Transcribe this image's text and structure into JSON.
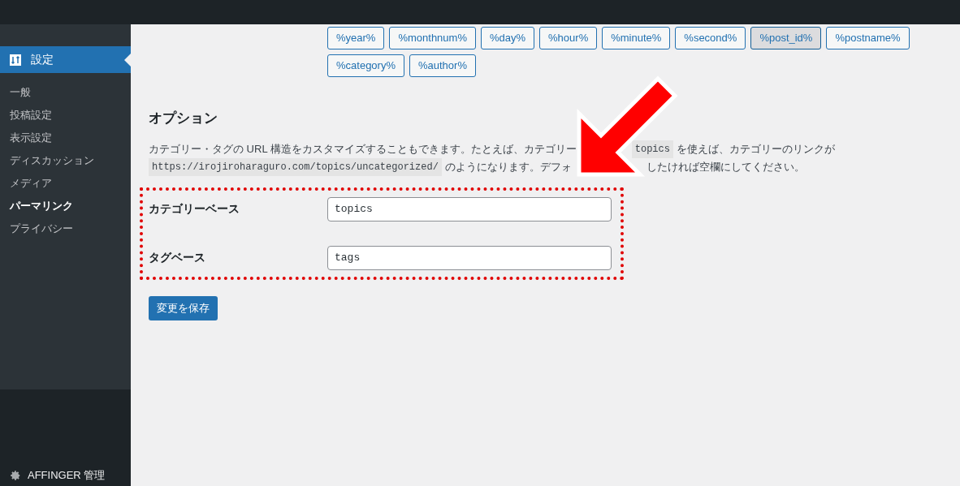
{
  "sidebar": {
    "current": {
      "label": "設定"
    },
    "items": [
      {
        "label": "一般",
        "selected": false
      },
      {
        "label": "投稿設定",
        "selected": false
      },
      {
        "label": "表示設定",
        "selected": false
      },
      {
        "label": "ディスカッション",
        "selected": false
      },
      {
        "label": "メディア",
        "selected": false
      },
      {
        "label": "パーマリンク",
        "selected": true
      },
      {
        "label": "プライバシー",
        "selected": false
      }
    ],
    "footer_item": {
      "label": "AFFINGER 管理"
    }
  },
  "tags": [
    {
      "label": "%year%",
      "selected": false
    },
    {
      "label": "%monthnum%",
      "selected": false
    },
    {
      "label": "%day%",
      "selected": false
    },
    {
      "label": "%hour%",
      "selected": false
    },
    {
      "label": "%minute%",
      "selected": false
    },
    {
      "label": "%second%",
      "selected": false
    },
    {
      "label": "%post_id%",
      "selected": true
    },
    {
      "label": "%postname%",
      "selected": false
    },
    {
      "label": "%category%",
      "selected": false
    },
    {
      "label": "%author%",
      "selected": false
    }
  ],
  "options": {
    "heading": "オプション",
    "description_line_1": {
      "before": "カテゴリー・タグの URL 構造をカスタマイズすることもできます。たとえば、カテゴリー",
      "code": "topics",
      "after": "を使えば、カテゴリーのリンクが"
    },
    "description_line_2": {
      "code": "https://irojiroharaguro.com/topics/uncategorized/",
      "before": "のようになります。デフォ",
      "after": "したければ空欄にしてください。"
    },
    "fields": [
      {
        "label": "カテゴリーベース",
        "value": "topics"
      },
      {
        "label": "タグベース",
        "value": "tags"
      }
    ],
    "save_button": "変更を保存"
  }
}
